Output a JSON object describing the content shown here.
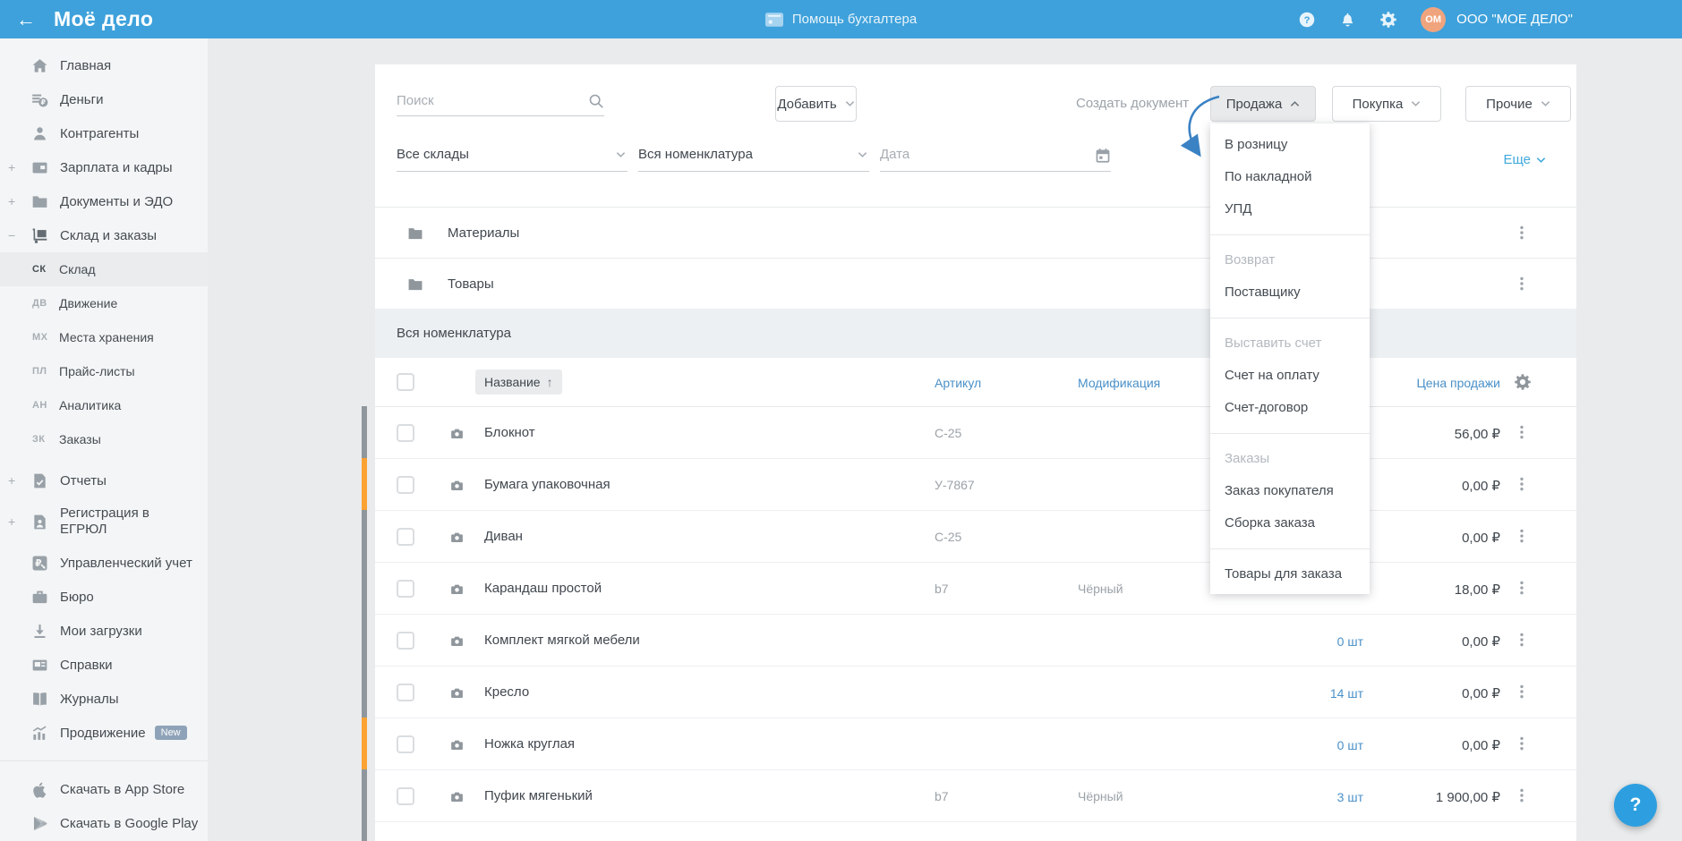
{
  "topbar": {
    "back_arrow": "←",
    "logo": "Моё дело",
    "helper_label": "Помощь бухгалтера",
    "company": "ООО \"МОЕ ДЕЛО\"",
    "avatar_initials": "ОМ"
  },
  "colors": {
    "topbar_blue": "#3EA1DB",
    "column_header_blue": "#4A90C8",
    "link_blue": "#3FA9DC",
    "orange_marker": "#FBA233",
    "gray_marker": "#8F979D",
    "avatar_bg": "#F0A47E"
  },
  "sidebar": {
    "top_items": [
      {
        "label": "Главная",
        "icon": "home-icon",
        "prefix": ""
      },
      {
        "label": "Деньги",
        "icon": "money-icon",
        "prefix": ""
      },
      {
        "label": "Контрагенты",
        "icon": "contractors-icon",
        "prefix": ""
      },
      {
        "label": "Зарплата и кадры",
        "icon": "salary-icon",
        "prefix": "+"
      },
      {
        "label": "Документы и ЭДО",
        "icon": "documents-icon",
        "prefix": "+"
      },
      {
        "label": "Склад и заказы",
        "icon": "warehouse-icon",
        "prefix": "−",
        "expanded": true
      }
    ],
    "sub_items": [
      {
        "code": "СК",
        "label": "Склад",
        "active": true
      },
      {
        "code": "ДВ",
        "label": "Движение"
      },
      {
        "code": "МХ",
        "label": "Места хранения"
      },
      {
        "code": "ПЛ",
        "label": "Прайс-листы"
      },
      {
        "code": "АН",
        "label": "Аналитика"
      },
      {
        "code": "ЗК",
        "label": "Заказы"
      }
    ],
    "bottom_items": [
      {
        "label": "Отчеты",
        "icon": "reports-icon",
        "prefix": "+",
        "gap": true
      },
      {
        "label": "Регистрация в ЕГРЮЛ",
        "icon": "registration-icon",
        "prefix": "+",
        "twoline": true
      },
      {
        "label": "Управленческий учет",
        "icon": "management-icon",
        "prefix": ""
      },
      {
        "label": "Бюро",
        "icon": "bureau-icon",
        "prefix": ""
      },
      {
        "label": "Мои загрузки",
        "icon": "downloads-icon",
        "prefix": ""
      },
      {
        "label": "Справки",
        "icon": "references-icon",
        "prefix": ""
      },
      {
        "label": "Журналы",
        "icon": "journals-icon",
        "prefix": ""
      },
      {
        "label": "Продвижение",
        "icon": "promotion-icon",
        "prefix": "",
        "badge": "New"
      }
    ],
    "store_items": [
      {
        "label": "Скачать в App Store",
        "icon": "appstore-icon"
      },
      {
        "label": "Скачать в Google Play",
        "icon": "googleplay-icon"
      }
    ]
  },
  "toolbar": {
    "search_placeholder": "Поиск",
    "add_button": "Добавить",
    "create_document_label": "Создать документ",
    "sale_button": "Продажа",
    "purchase_button": "Покупка",
    "other_button": "Прочие",
    "more_link": "Еще"
  },
  "filters": {
    "warehouses": "Все склады",
    "nomenclature": "Вся номенклатура",
    "date_placeholder": "Дата"
  },
  "sale_menu": {
    "groups": [
      {
        "header": null,
        "items": [
          "В розницу",
          "По накладной",
          "УПД"
        ]
      },
      {
        "header": "Возврат",
        "items": [
          "Поставщику"
        ]
      },
      {
        "header": "Выставить счет",
        "items": [
          "Счет на оплату",
          "Счет-договор"
        ]
      },
      {
        "header": "Заказы",
        "items": [
          "Заказ покупателя",
          "Сборка заказа"
        ]
      },
      {
        "header": null,
        "items": [
          "Товары для заказа"
        ]
      }
    ]
  },
  "folders": [
    {
      "name": "Материалы"
    },
    {
      "name": "Товары"
    }
  ],
  "section_title": "Вся номенклатура",
  "table": {
    "headers": {
      "name": "Название",
      "sku": "Артикул",
      "modification": "Модификация",
      "price": "Цена продажи"
    },
    "rows": [
      {
        "accent": "gray",
        "name": "Блокнот",
        "sku": "С-25",
        "modification": "",
        "stock": "",
        "price": "56,00 ₽"
      },
      {
        "accent": "orange",
        "name": "Бумага упаковочная",
        "sku": "У-7867",
        "modification": "",
        "stock": "",
        "price": "0,00 ₽"
      },
      {
        "accent": "gray",
        "name": "Диван",
        "sku": "С-25",
        "modification": "",
        "stock": "",
        "price": "0,00 ₽"
      },
      {
        "accent": "gray",
        "name": "Карандаш простой",
        "sku": "b7",
        "modification": "Чёрный",
        "stock": "",
        "price": "18,00 ₽"
      },
      {
        "accent": "gray",
        "name": "Комплект мягкой мебели",
        "sku": "",
        "modification": "",
        "stock": "0 шт",
        "price": "0,00 ₽"
      },
      {
        "accent": "gray",
        "name": "Кресло",
        "sku": "",
        "modification": "",
        "stock": "14 шт",
        "price": "0,00 ₽"
      },
      {
        "accent": "orange",
        "name": "Ножка круглая",
        "sku": "",
        "modification": "",
        "stock": "0 шт",
        "price": "0,00 ₽"
      },
      {
        "accent": "gray",
        "name": "Пуфик мягенький",
        "sku": "b7",
        "modification": "Чёрный",
        "stock": "3 шт",
        "price": "1 900,00 ₽"
      }
    ]
  },
  "fab": {
    "label": "?"
  }
}
